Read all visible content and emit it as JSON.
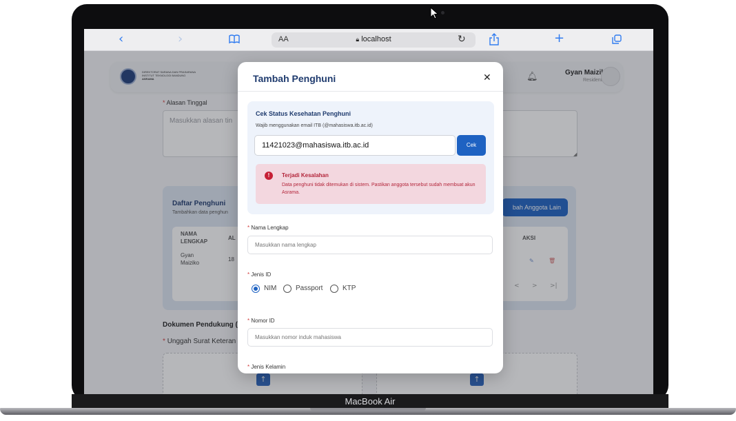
{
  "device": {
    "label": "MacBook Air"
  },
  "browser": {
    "text_size_label": "AA",
    "url": "localhost",
    "back_icon": "chevron-left-icon",
    "forward_icon": "chevron-right-icon",
    "bookmarks_icon": "book-icon",
    "reload_icon": "reload-icon",
    "share_icon": "share-icon",
    "new_tab_icon": "plus-icon",
    "tabs_icon": "tabs-icon"
  },
  "header": {
    "logo_line1": "DIREKTORAT SARANA DAN PRASARANA",
    "logo_line2": "INSTITUT TEKNOLOGI BANDUNG",
    "logo_line3": "ASRAMA",
    "user_name": "Gyan Maiziko",
    "user_role": "Resident"
  },
  "background_form": {
    "alasan_label": "Alasan Tinggal",
    "alasan_placeholder": "Masukkan alasan tin",
    "daftar_title": "Daftar Penghuni",
    "daftar_sub": "Tambahkan data penghun",
    "add_button": "bah Anggota Lain",
    "table": {
      "col_name_1": "NAMA",
      "col_name_2": "LENGKAP",
      "col_2": "AL",
      "col_actions": "AKSI",
      "row_name_1": "Gyan",
      "row_name_2": "Maiziko",
      "row_col2": "18",
      "pager_prev": "<",
      "pager_next": ">",
      "pager_last": ">|"
    },
    "dokumen_title": "Dokumen Pendukung (",
    "upload_label": "Unggah Surat Keteran"
  },
  "modal": {
    "title": "Tambah Penghuni",
    "close": "✕",
    "cek": {
      "title": "Cek Status Kesehatan Penghuni",
      "note": "Wajib menggunakan email ITB (@mahasiswa.itb.ac.id)",
      "email_value": "11421023@mahasiswa.itb.ac.id",
      "button": "Cek",
      "error_title": "Terjadi Kesalahan",
      "error_text": "Data penghuni tidak ditemukan di sistem. Pastikan anggota tersebut sudah membuat akun Asrama."
    },
    "fields": {
      "nama_label": "Nama Lengkap",
      "nama_placeholder": "Masukkan nama lengkap",
      "jenis_id_label": "Jenis ID",
      "id_options": [
        "NIM",
        "Passport",
        "KTP"
      ],
      "id_selected": "NIM",
      "nomor_label": "Nomor ID",
      "nomor_placeholder": "Masukkan nomor induk mahasiswa",
      "kelamin_label": "Jenis Kelamin"
    }
  },
  "colors": {
    "primary": "#1e62c2",
    "title": "#1f3b6e",
    "error_bg": "#f3d7df",
    "error_text": "#b3253a"
  }
}
